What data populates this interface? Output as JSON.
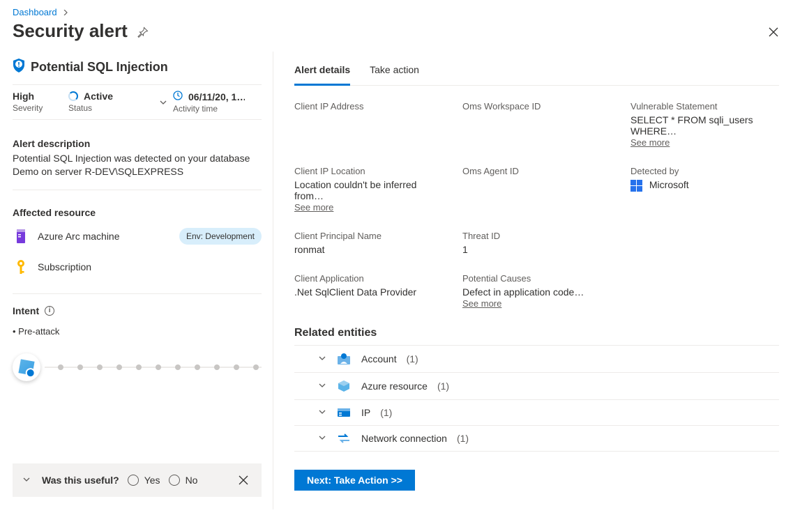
{
  "breadcrumb": {
    "root": "Dashboard"
  },
  "page_title": "Security alert",
  "left": {
    "alert_title": "Potential SQL Injection",
    "severity_value": "High",
    "severity_label": "Severity",
    "status_value": "Active",
    "status_label": "Status",
    "activity_time_value": "06/11/20, 1…",
    "activity_time_label": "Activity time",
    "description_h": "Alert description",
    "description": "Potential SQL Injection was detected on your database Demo on server R-DEV\\SQLEXPRESS",
    "affected_h": "Affected resource",
    "resources": [
      {
        "label": "Azure Arc machine",
        "tag": "Env: Development"
      },
      {
        "label": "Subscription"
      }
    ],
    "intent_h": "Intent",
    "intent_item": "Pre-attack"
  },
  "feedback": {
    "question": "Was this useful?",
    "yes": "Yes",
    "no": "No"
  },
  "right": {
    "tabs": {
      "details": "Alert details",
      "action": "Take action"
    },
    "fields": {
      "c1r1_label": "Client IP Address",
      "c2r1_label": "Oms Workspace ID",
      "c3r1_label": "Vulnerable Statement",
      "c3r1_value": "SELECT * FROM sqli_users WHERE…",
      "c1r2_label": "Client IP Location",
      "c1r2_value": "Location couldn't be inferred from…",
      "c2r2_label": "Oms Agent ID",
      "c3r2_label": "Detected by",
      "c3r2_value": "Microsoft",
      "c1r3_label": "Client Principal Name",
      "c1r3_value": "ronmat",
      "c2r3_label": "Threat ID",
      "c2r3_value": "1",
      "c1r4_label": "Client Application",
      "c1r4_value": ".Net SqlClient Data Provider",
      "c2r4_label": "Potential Causes",
      "c2r4_value": "Defect in application code…",
      "see_more": "See more"
    },
    "related_h": "Related entities",
    "entities": [
      {
        "label": "Account",
        "count": "(1)"
      },
      {
        "label": "Azure resource",
        "count": "(1)"
      },
      {
        "label": "IP",
        "count": "(1)"
      },
      {
        "label": "Network connection",
        "count": "(1)"
      }
    ],
    "next_btn": "Next: Take Action  >>"
  }
}
